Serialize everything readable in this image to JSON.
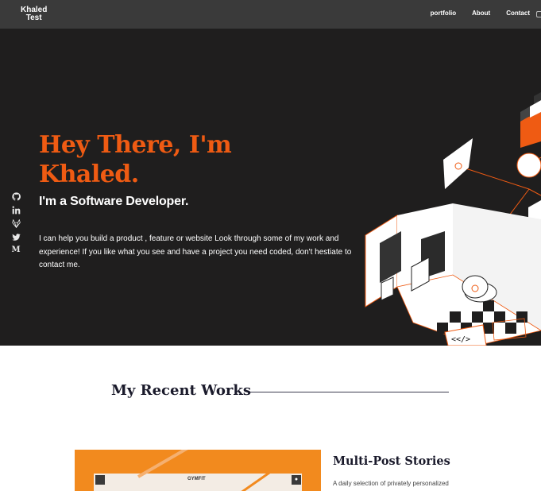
{
  "nav": {
    "logo_line1": "Khaled",
    "logo_line2": "Test",
    "links": [
      {
        "label": "portfolio"
      },
      {
        "label": "About"
      },
      {
        "label": "Contact"
      }
    ]
  },
  "hero": {
    "title_line1": "Hey There, I'm",
    "title_line2": "Khaled.",
    "subtitle": "I'm a Software Developer.",
    "description": "I can help you build a product , feature or website Look through some of my work and experience! If you like what you see and have a project you need coded, don't hestiate to contact me.",
    "social_icons": [
      "github-icon",
      "linkedin-icon",
      "gitlab-icon",
      "twitter-icon",
      "medium-icon"
    ],
    "code_badge": "<</>"
  },
  "works": {
    "heading": "My Recent Works",
    "projects": [
      {
        "title": "Multi-Post Stories",
        "description": "A daily selection of privately personalized",
        "mock_logo": "GYMFIT"
      }
    ]
  },
  "colors": {
    "accent": "#ef5b13",
    "nav_bg": "#3a3a3a",
    "hero_bg": "#1f1e1e",
    "project_bg": "#f28a1e"
  }
}
